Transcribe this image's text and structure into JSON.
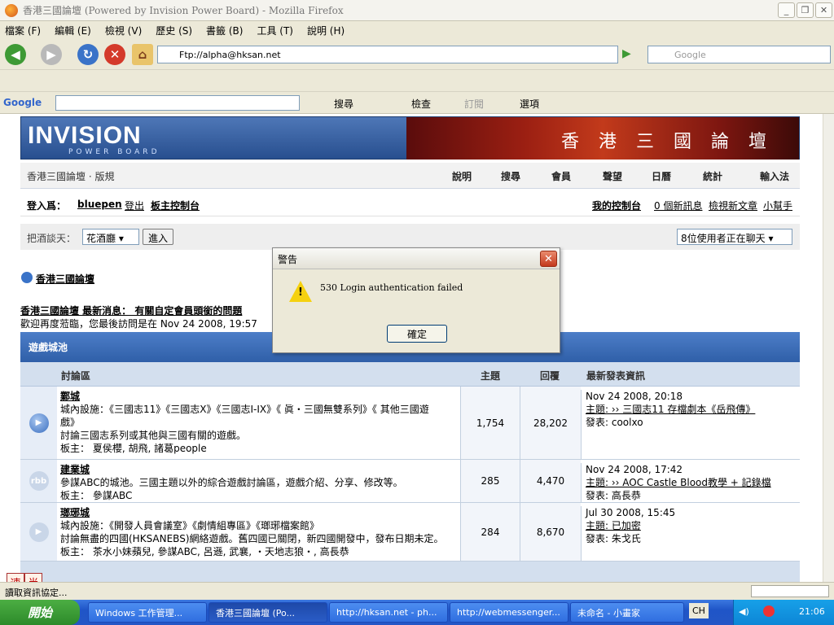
{
  "window": {
    "title": "香港三國論壇 (Powered by Invision Power Board) - Mozilla Firefox"
  },
  "menu": [
    "檔案 (F)",
    "編輯 (E)",
    "檢視 (V)",
    "歷史 (S)",
    "書籤 (B)",
    "工具 (T)",
    "說明 (H)"
  ],
  "nav": {
    "url": "Ftp://alpha@hksan.net",
    "search_placeholder": "Google"
  },
  "google_bar": {
    "logo": "Google",
    "search": "搜尋",
    "check": "檢查",
    "subscribe": "訂閱",
    "options": "選項"
  },
  "forum": {
    "logo": "INVISION",
    "logo_sub": "POWER BOARD",
    "banner_text": "香港三國論壇",
    "breadcrumb": "香港三國論壇 · 版規",
    "nav_links": [
      "說明",
      "搜尋",
      "會員",
      "聲望",
      "日曆",
      "統計",
      "輸入法"
    ],
    "login_prefix": "登入爲：",
    "username": "bluepen",
    "logout": "登出",
    "admin_cp": "板主控制台",
    "my_cp": "我的控制台",
    "new_msgs": "0 個新訊息",
    "view_new": "檢視新文章",
    "assistant": "小幫手",
    "chat_label": "把酒談天：",
    "chat_room": "花酒廳",
    "enter": "進入",
    "online": "8位使用者正在聊天",
    "board_title": "香港三國論壇",
    "news_title": "香港三國論壇 最新消息： 有關自定會員頭銜的問題",
    "welcome": "歡迎再度蒞臨，您最後訪問是在 Nov 24 2008, 19:57",
    "category": "遊戲城池",
    "col_forum": "討論區",
    "col_topics": "主題",
    "col_replies": "回覆",
    "col_last": "最新發表資訊",
    "rows": [
      {
        "name": "鄴城",
        "desc1": "城內設施：《三國志11》《三國志X》《三國志I-IX》《 眞・三國無雙系列》《 其他三國遊",
        "desc2": "戲》",
        "desc3": "討論三國志系列或其他與三國有關的遊戲。",
        "mods": "板主： 夏侯櫻, 胡飛, 諸葛people",
        "topics": "1,754",
        "replies": "28,202",
        "date": "Nov 24 2008, 20:18",
        "topic": "主題: ›› 三國志11 存檔劇本《岳飛傳》",
        "poster": "發表: coolxo"
      },
      {
        "name": "建業城",
        "desc1": "參謀ABC的城池。三國主題以外的綜合遊戲討論區，遊戲介紹、分享、修改等。",
        "desc2": "",
        "desc3": "",
        "mods": "板主： 參謀ABC",
        "topics": "285",
        "replies": "4,470",
        "date": "Nov 24 2008, 17:42",
        "topic": "主題: ›› AOC Castle Blood教學 + 記錄檔",
        "poster": "發表: 高長恭"
      },
      {
        "name": "瑯琊城",
        "desc1": "城內設施：《開發人員會議室》《劇情組專區》《瑯琊檔案館》",
        "desc2": "",
        "desc3": "討論無盡的四國(HKSANEBS)網絡遊戲。舊四國已關閉，新四國開發中，發布日期未定。",
        "mods": "板主： 茶水小妹蘋兒, 參謀ABC, 呂遜, 武襄, ・天地志狼・, 高長恭",
        "topics": "284",
        "replies": "8,670",
        "date": "Jul 30 2008, 15:45",
        "topic": "主題: 已加密",
        "poster": "發表: 朱戈氏"
      }
    ]
  },
  "dialog": {
    "title": "警告",
    "message": "530 Login authentication failed",
    "ok": "確定"
  },
  "status": "讀取資訊協定...",
  "ime": {
    "a": "速",
    "b": "半"
  },
  "taskbar": {
    "start": "開始",
    "items": [
      "Windows 工作管理...",
      "香港三國論壇 (Po...",
      "http://hksan.net - ph...",
      "http://webmessenger...",
      "未命名 - 小畫家"
    ],
    "lang": "CH",
    "time": "21:06"
  }
}
